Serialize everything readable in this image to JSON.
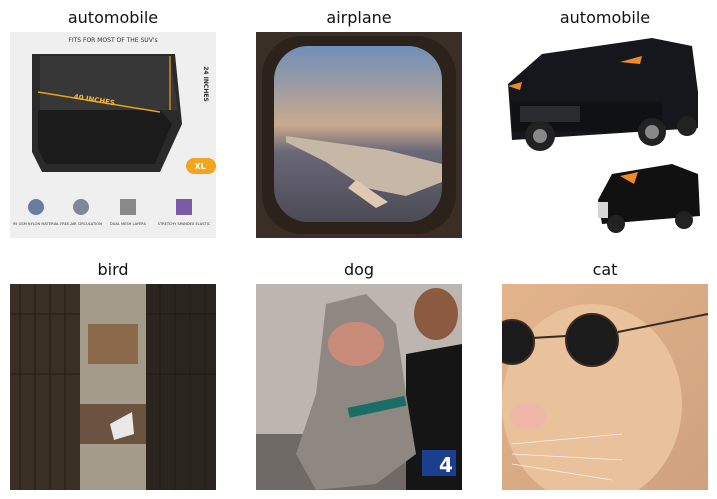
{
  "figure": {
    "panels": [
      {
        "label": "automobile",
        "description": "car window sunshade product image (40 inches × 24 inches, XL) with feature icons"
      },
      {
        "label": "airplane",
        "description": "view through an airplane window of a wing above clouds at sunset"
      },
      {
        "label": "automobile",
        "description": "black SUV with a car cover, two views"
      },
      {
        "label": "bird",
        "description": "inside of a wire cage / aviary with wooden structures"
      },
      {
        "label": "dog",
        "description": "pit bull dog with open mouth, person in background, TV logo 4"
      },
      {
        "label": "cat",
        "description": "close-up of an orange cat wearing round dark sunglasses"
      }
    ],
    "panel0_texts": {
      "header": "FITS FOR MOST OF THE SUV's",
      "width": "40 INCHES",
      "height": "24 INCHES",
      "size": "XL",
      "features": [
        "95 GSM NYLON MATERIAL",
        "FREE-AIR CIRCULATION",
        "DUAL MESH LAYERS",
        "STRETCHY SPANDEX ELASTIC"
      ]
    },
    "panel4_logo": "4"
  }
}
